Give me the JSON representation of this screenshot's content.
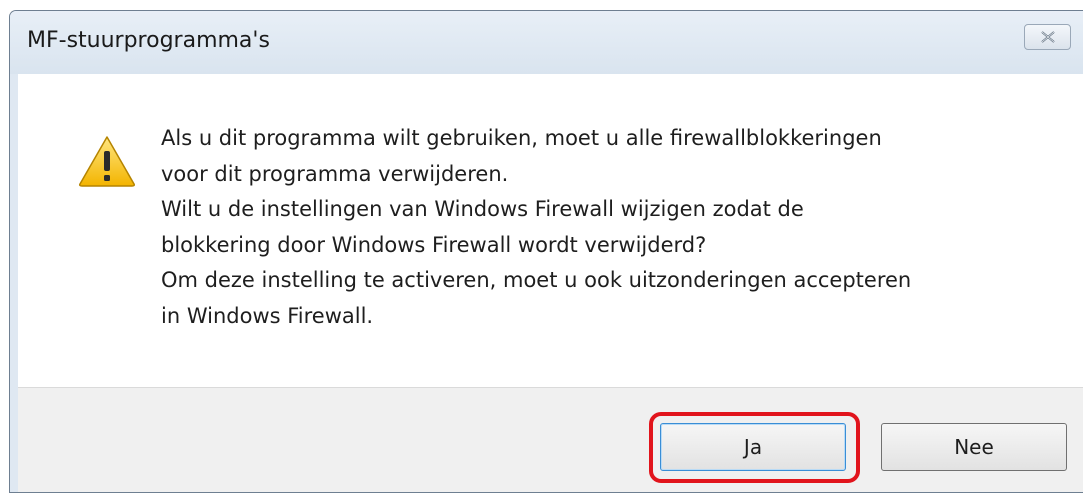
{
  "dialog": {
    "title": "MF-stuurprogramma's",
    "close_icon": "close-icon",
    "warning_icon": "warning-icon",
    "message_lines": [
      "Als u dit programma wilt gebruiken, moet u alle firewallblokkeringen",
      "voor dit programma verwijderen.",
      "Wilt u de instellingen van Windows Firewall wijzigen zodat de",
      "blokkering door Windows Firewall wordt verwijderd?",
      "Om deze instelling te activeren, moet u ook uitzonderingen accepteren",
      "in Windows Firewall."
    ],
    "buttons": {
      "yes_label": "Ja",
      "no_label": "Nee"
    },
    "highlight_color": "#e1141c"
  }
}
